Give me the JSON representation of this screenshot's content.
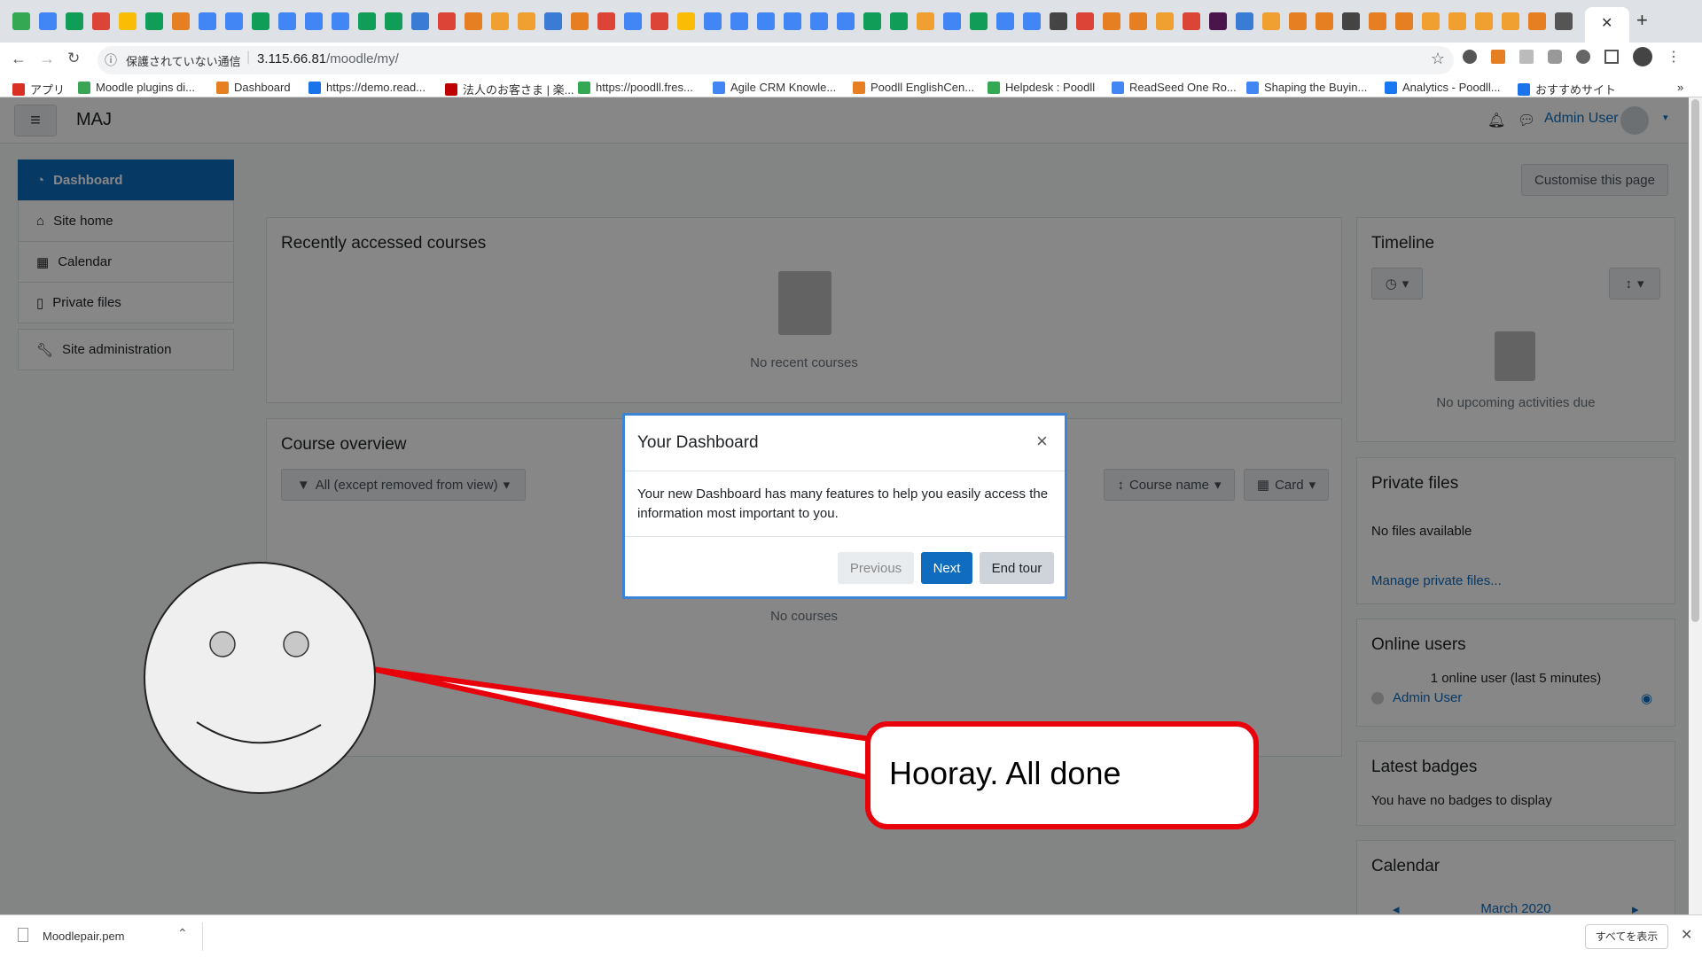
{
  "browser": {
    "url_warning": "保護されていない通信",
    "url_host": "3.115.66.81",
    "url_path": "/moodle/my/",
    "bookmarks": [
      "アプリ",
      "Moodle plugins di...",
      "Dashboard",
      "https://demo.read...",
      "法人のお客さま | 楽...",
      "https://poodll.fres...",
      "Agile CRM Knowle...",
      "Poodll EnglishCen...",
      "Helpdesk : Poodll",
      "ReadSeed One Ro...",
      "Shaping the Buyin...",
      "Analytics - Poodll...",
      "おすすめサイト"
    ],
    "bookmarks_more": "»"
  },
  "navbar": {
    "site_name": "MAJ",
    "user_name": "Admin User"
  },
  "sidebar": {
    "items": [
      {
        "label": "Dashboard",
        "icon": "dashboard-icon"
      },
      {
        "label": "Site home",
        "icon": "home-icon"
      },
      {
        "label": "Calendar",
        "icon": "calendar-icon"
      },
      {
        "label": "Private files",
        "icon": "file-icon"
      },
      {
        "label": "Site administration",
        "icon": "wrench-icon"
      }
    ]
  },
  "main": {
    "customise_button": "Customise this page",
    "recent": {
      "title": "Recently accessed courses",
      "empty": "No recent courses"
    },
    "overview": {
      "title": "Course overview",
      "filter": "All (except removed from view)",
      "sort": "Course name",
      "view": "Card",
      "empty": "No courses"
    }
  },
  "right": {
    "timeline": {
      "title": "Timeline",
      "empty": "No upcoming activities due"
    },
    "private_files": {
      "title": "Private files",
      "empty": "No files available",
      "link": "Manage private files..."
    },
    "online_users": {
      "title": "Online users",
      "summary": "1 online user (last 5 minutes)",
      "user": "Admin User"
    },
    "badges": {
      "title": "Latest badges",
      "empty": "You have no badges to display"
    },
    "calendar": {
      "title": "Calendar",
      "month": "March 2020"
    }
  },
  "modal": {
    "title": "Your Dashboard",
    "close": "×",
    "body": "Your new Dashboard has many features to help you easily access the information most important to you.",
    "prev": "Previous",
    "next": "Next",
    "end": "End tour"
  },
  "speech": {
    "text": "Hooray. All done"
  },
  "download": {
    "file": "Moodlepair.pem",
    "show_all": "すべてを表示"
  },
  "colors": {
    "primary": "#0f6cbf",
    "speech_border": "#e8000b"
  }
}
